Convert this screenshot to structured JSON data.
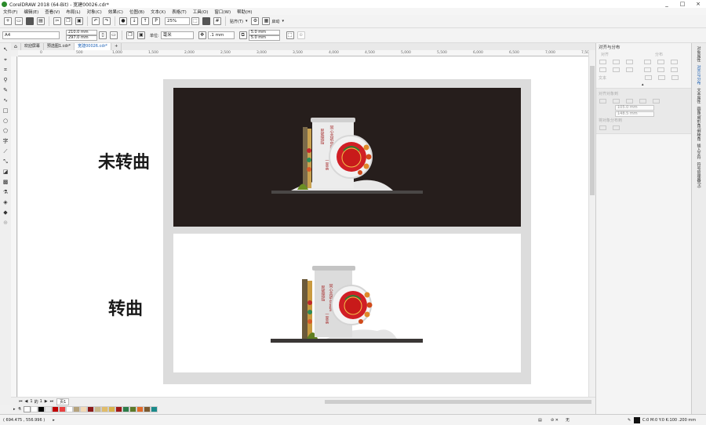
{
  "window": {
    "title": "CorelDRAW 2018 (64-Bit) - 宽建00026.cdr*",
    "controls": [
      "_",
      "□",
      "×"
    ]
  },
  "menu": [
    "文件(F)",
    "编辑(E)",
    "查看(V)",
    "布局(L)",
    "对象(C)",
    "效果(C)",
    "位图(B)",
    "文本(X)",
    "表格(T)",
    "工具(O)",
    "窗口(W)",
    "帮助(H)"
  ],
  "toolbar": {
    "zoom": "25%",
    "snap_label": "贴齐(T)",
    "launch_label": "启动"
  },
  "property_bar": {
    "page_size": "A4",
    "width": "210.0 mm",
    "height": "297.0 mm",
    "units_label": "单位:",
    "units": "毫米",
    "nudge": ".1 mm",
    "dup_x": "5.0 mm",
    "dup_y": "5.0 mm"
  },
  "doc_tabs": [
    {
      "label": "欢迎屏幕",
      "active": false
    },
    {
      "label": "预选图1.cdr*",
      "active": false
    },
    {
      "label": "宽建00026.cdr*",
      "active": true
    }
  ],
  "ruler_ticks": [
    "-1,000",
    "0",
    "500",
    "1,000",
    "1,500",
    "2,000",
    "2,500",
    "3,000",
    "3,500",
    "4,000",
    "4,500",
    "5,000",
    "5,500",
    "6,000",
    "6,500",
    "7,000",
    "7,500"
  ],
  "canvas": {
    "label_top": "未转曲",
    "label_bottom": "转曲",
    "sign_text_1": "民族团结",
    "sign_text_2": "同心共筑中国梦",
    "sign_text_3": "一家亲",
    "page_bg": "#dcdcdc",
    "panel_dark": "#261e1c"
  },
  "page_nav": {
    "current": "1",
    "of": "的",
    "total": "1",
    "page_tab": "页1"
  },
  "palette": [
    "#ffffff",
    "#000000",
    "#e8e8e8",
    "#c00000",
    "#e94040",
    "#ffffff",
    "#b5a27b",
    "#f2d9b5",
    "#8c1a1a",
    "#c8b88a",
    "#e0bc6a",
    "#d8b24a",
    "#a01818",
    "#2e7d4a",
    "#5b7a2a",
    "#e26a2a",
    "#7a5a30",
    "#1b8a8a"
  ],
  "status": {
    "coords": "( 694.475 , 556.996 )",
    "fill_label": "无",
    "color_info": "C:0 M:0 Y:0 K:100 .200 mm"
  },
  "docker": {
    "title": "对齐与分布",
    "align_label": "对齐",
    "distribute_label": "分布",
    "text_label": "文本",
    "align_objects_label": "对齐对象到",
    "x_value": "105.0 mm",
    "y_value": "148.5 mm",
    "distribute_objects_label": "将对象分布到",
    "side_tabs": [
      "对象属性",
      "对齐与分布",
      "文本属性",
      "圆角/扇形角/倒棱角",
      "插入字符",
      "符号管理器(H)"
    ]
  }
}
